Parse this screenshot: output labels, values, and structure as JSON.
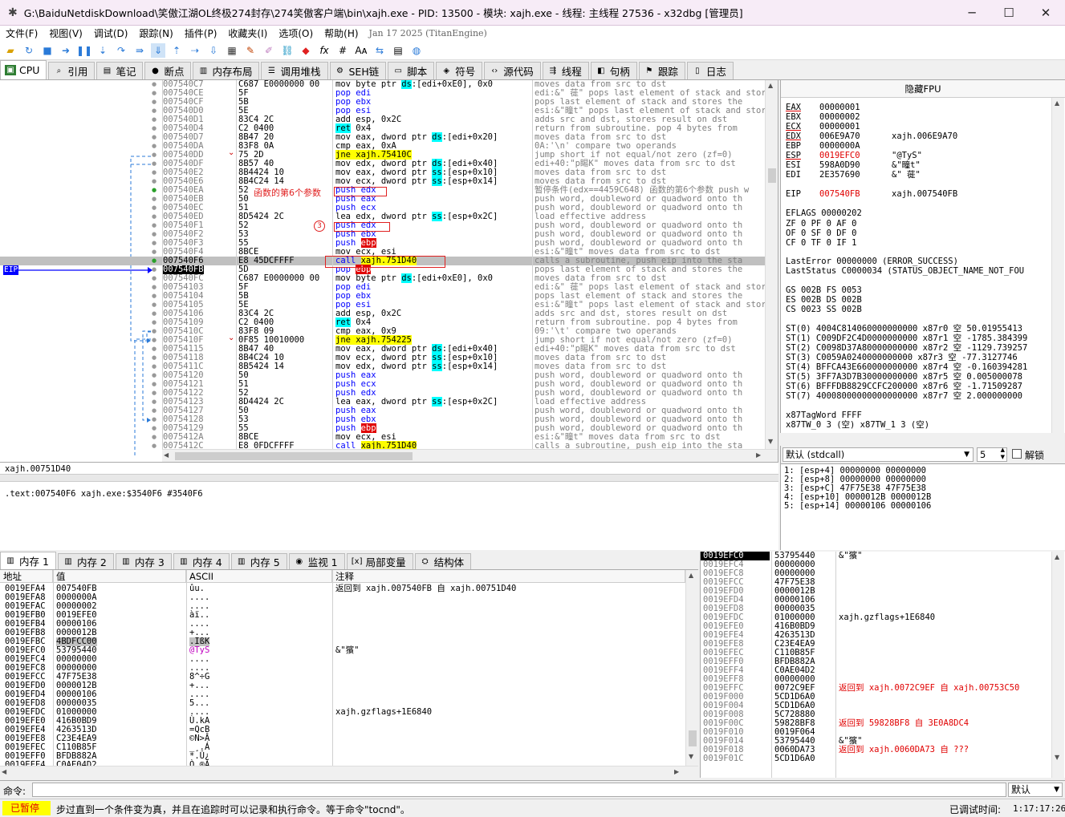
{
  "window": {
    "title": "G:\\BaiduNetdiskDownload\\笑傲江湖OL终极274封存\\274笑傲客户端\\bin\\xajh.exe - PID: 13500 - 模块: xajh.exe - 线程: 主线程 27536 - x32dbg [管理员]",
    "min": "─",
    "max": "☐",
    "close": "✕"
  },
  "menu": {
    "items": [
      "文件(F)",
      "视图(V)",
      "调试(D)",
      "跟踪(N)",
      "插件(P)",
      "收藏夹(I)",
      "选项(O)",
      "帮助(H)"
    ],
    "date": "Jan 17 2025 (TitanEngine)"
  },
  "tabs": [
    {
      "label": "CPU",
      "icon": "cpu-icon"
    },
    {
      "label": "引用",
      "icon": "search-icon"
    },
    {
      "label": "笔记",
      "icon": "notes-icon"
    },
    {
      "label": "断点",
      "icon": "breakpoint-icon"
    },
    {
      "label": "内存布局",
      "icon": "memory-map-icon"
    },
    {
      "label": "调用堆栈",
      "icon": "call-stack-icon"
    },
    {
      "label": "SEH链",
      "icon": "seh-icon"
    },
    {
      "label": "脚本",
      "icon": "script-icon"
    },
    {
      "label": "符号",
      "icon": "symbol-icon"
    },
    {
      "label": "源代码",
      "icon": "source-icon"
    },
    {
      "label": "线程",
      "icon": "thread-icon"
    },
    {
      "label": "句柄",
      "icon": "handle-icon"
    },
    {
      "label": "跟踪",
      "icon": "trace-icon"
    },
    {
      "label": "日志",
      "icon": "log-icon"
    }
  ],
  "disasm": [
    {
      "addr": "007540C7",
      "bytes": "C687 E0000000 00",
      "ins": [
        [
          "",
          "mov byte ptr "
        ],
        [
          "seg",
          "ds"
        ],
        [
          "",
          ":[edi+0xE0], 0x0"
        ]
      ],
      "cmt": "moves data from src to dst"
    },
    {
      "addr": "007540CE",
      "bytes": "5F",
      "ins": [
        [
          "push",
          "pop edi"
        ]
      ],
      "cmt": "edi:&\" 蓰\" pops last element of stack and stores the"
    },
    {
      "addr": "007540CF",
      "bytes": "5B",
      "ins": [
        [
          "push",
          "pop ebx"
        ]
      ],
      "cmt": "pops last element of stack and stores the"
    },
    {
      "addr": "007540D0",
      "bytes": "5E",
      "ins": [
        [
          "push",
          "pop esi"
        ]
      ],
      "cmt": "esi:&\"疃t\" pops last element of stack and stores the"
    },
    {
      "addr": "007540D1",
      "bytes": "83C4 2C",
      "ins": [
        [
          "",
          "add esp, 0x2C"
        ]
      ],
      "cmt": "adds src and dst, stores result on dst"
    },
    {
      "addr": "007540D4",
      "bytes": "C2 0400",
      "ins": [
        [
          "ret",
          "ret"
        ],
        [
          "",
          " 0x4"
        ]
      ],
      "cmt": "return from subroutine. pop 4 bytes from"
    },
    {
      "addr": "007540D7",
      "bytes": "8B47 20",
      "ins": [
        [
          "",
          "mov eax, dword ptr "
        ],
        [
          "seg",
          "ds"
        ],
        [
          "",
          ":[edi+0x20]"
        ]
      ],
      "cmt": "moves data from src to dst"
    },
    {
      "addr": "007540DA",
      "bytes": "83F8 0A",
      "ins": [
        [
          "",
          "cmp eax, 0xA"
        ]
      ],
      "cmt": "0A:'\\n' compare two operands"
    },
    {
      "addr": "007540DD",
      "bytes": "75 2D",
      "ins": [
        [
          "jmp",
          "jne xajh.75410C"
        ]
      ],
      "cmt": "jump short if not equal/not zero (zf=0)"
    },
    {
      "addr": "007540DF",
      "bytes": "8B57 40",
      "ins": [
        [
          "",
          "mov edx, dword ptr "
        ],
        [
          "seg",
          "ds"
        ],
        [
          "",
          ":[edi+0x40]"
        ]
      ],
      "cmt": "edi+40:\"p睗K\" moves data from src to dst"
    },
    {
      "addr": "007540E2",
      "bytes": "8B4424 10",
      "ins": [
        [
          "",
          "mov eax, dword ptr "
        ],
        [
          "seg",
          "ss"
        ],
        [
          "",
          ":[esp+0x10]"
        ]
      ],
      "cmt": "moves data from src to dst"
    },
    {
      "addr": "007540E6",
      "bytes": "8B4C24 14",
      "ins": [
        [
          "",
          "mov ecx, dword ptr "
        ],
        [
          "seg",
          "ss"
        ],
        [
          "",
          ":[esp+0x14]"
        ]
      ],
      "cmt": "moves data from src to dst"
    },
    {
      "addr": "007540EA",
      "bytes": "52",
      "ins": [
        [
          "push",
          "push edx"
        ]
      ],
      "cmt": "暂停条件(edx==4459C648) 函数的第6个参数 push w"
    },
    {
      "addr": "007540EB",
      "bytes": "50",
      "ins": [
        [
          "push",
          "push eax"
        ]
      ],
      "cmt": "push word, doubleword or quadword onto th"
    },
    {
      "addr": "007540EC",
      "bytes": "51",
      "ins": [
        [
          "push",
          "push ecx"
        ]
      ],
      "cmt": "push word, doubleword or quadword onto th"
    },
    {
      "addr": "007540ED",
      "bytes": "8D5424 2C",
      "ins": [
        [
          "",
          "lea edx, dword ptr "
        ],
        [
          "seg",
          "ss"
        ],
        [
          "",
          ":[esp+0x2C]"
        ]
      ],
      "cmt": "load effective address"
    },
    {
      "addr": "007540F1",
      "bytes": "52",
      "ins": [
        [
          "push",
          "push edx"
        ]
      ],
      "cmt": "push word, doubleword or quadword onto th"
    },
    {
      "addr": "007540F2",
      "bytes": "53",
      "ins": [
        [
          "push",
          "push ebx"
        ]
      ],
      "cmt": "push word, doubleword or quadword onto th"
    },
    {
      "addr": "007540F3",
      "bytes": "55",
      "ins": [
        [
          "push",
          "push "
        ],
        [
          "ebp",
          "ebp"
        ]
      ],
      "cmt": "push word, doubleword or quadword onto th"
    },
    {
      "addr": "007540F4",
      "bytes": "8BCE",
      "ins": [
        [
          "",
          "mov ecx, esi"
        ]
      ],
      "cmt": "esi:&\"疃t\" moves data from src to dst"
    },
    {
      "addr": "007540F6",
      "bytes": "E8 45DCFFFF",
      "ins": [
        [
          "push",
          "call "
        ],
        [
          "call",
          "xajh.751D40"
        ]
      ],
      "cmt": "calls a subroutine, push eip into the sta",
      "sel": true
    },
    {
      "addr": "007540FB",
      "bytes": "5D",
      "ins": [
        [
          "push",
          "pop "
        ],
        [
          "ebp",
          "ebp"
        ]
      ],
      "cmt": "pops last element of stack and stores the",
      "eip": true
    },
    {
      "addr": "007540FC",
      "bytes": "C687 E0000000 00",
      "ins": [
        [
          "",
          "mov byte ptr "
        ],
        [
          "seg",
          "ds"
        ],
        [
          "",
          ":[edi+0xE0], 0x0"
        ]
      ],
      "cmt": "moves data from src to dst"
    },
    {
      "addr": "00754103",
      "bytes": "5F",
      "ins": [
        [
          "push",
          "pop edi"
        ]
      ],
      "cmt": "edi:&\" 蓰\" pops last element of stack and stores the"
    },
    {
      "addr": "00754104",
      "bytes": "5B",
      "ins": [
        [
          "push",
          "pop ebx"
        ]
      ],
      "cmt": "pops last element of stack and stores the"
    },
    {
      "addr": "00754105",
      "bytes": "5E",
      "ins": [
        [
          "push",
          "pop esi"
        ]
      ],
      "cmt": "esi:&\"疃t\" pops last element of stack and stores the"
    },
    {
      "addr": "00754106",
      "bytes": "83C4 2C",
      "ins": [
        [
          "",
          "add esp, 0x2C"
        ]
      ],
      "cmt": "adds src and dst, stores result on dst"
    },
    {
      "addr": "00754109",
      "bytes": "C2 0400",
      "ins": [
        [
          "ret",
          "ret"
        ],
        [
          "",
          " 0x4"
        ]
      ],
      "cmt": "return from subroutine. pop 4 bytes from"
    },
    {
      "addr": "0075410C",
      "bytes": "83F8 09",
      "ins": [
        [
          "",
          "cmp eax, 0x9"
        ]
      ],
      "cmt": "09:'\\t' compare two operands"
    },
    {
      "addr": "0075410F",
      "bytes": "0F85 10010000",
      "ins": [
        [
          "jmp",
          "jne xajh.754225"
        ]
      ],
      "cmt": "jump short if not equal/not zero (zf=0)"
    },
    {
      "addr": "00754115",
      "bytes": "8B47 40",
      "ins": [
        [
          "",
          "mov eax, dword ptr "
        ],
        [
          "seg",
          "ds"
        ],
        [
          "",
          ":[edi+0x40]"
        ]
      ],
      "cmt": "edi+40:\"p睗K\" moves data from src to dst"
    },
    {
      "addr": "00754118",
      "bytes": "8B4C24 10",
      "ins": [
        [
          "",
          "mov ecx, dword ptr "
        ],
        [
          "seg",
          "ss"
        ],
        [
          "",
          ":[esp+0x10]"
        ]
      ],
      "cmt": "moves data from src to dst"
    },
    {
      "addr": "0075411C",
      "bytes": "8B5424 14",
      "ins": [
        [
          "",
          "mov edx, dword ptr "
        ],
        [
          "seg",
          "ss"
        ],
        [
          "",
          ":[esp+0x14]"
        ]
      ],
      "cmt": "moves data from src to dst"
    },
    {
      "addr": "00754120",
      "bytes": "50",
      "ins": [
        [
          "push",
          "push eax"
        ]
      ],
      "cmt": "push word, doubleword or quadword onto th"
    },
    {
      "addr": "00754121",
      "bytes": "51",
      "ins": [
        [
          "push",
          "push ecx"
        ]
      ],
      "cmt": "push word, doubleword or quadword onto th"
    },
    {
      "addr": "00754122",
      "bytes": "52",
      "ins": [
        [
          "push",
          "push edx"
        ]
      ],
      "cmt": "push word, doubleword or quadword onto th"
    },
    {
      "addr": "00754123",
      "bytes": "8D4424 2C",
      "ins": [
        [
          "",
          "lea eax, dword ptr "
        ],
        [
          "seg",
          "ss"
        ],
        [
          "",
          ":[esp+0x2C]"
        ]
      ],
      "cmt": "load effective address"
    },
    {
      "addr": "00754127",
      "bytes": "50",
      "ins": [
        [
          "push",
          "push eax"
        ]
      ],
      "cmt": "push word, doubleword or quadword onto th"
    },
    {
      "addr": "00754128",
      "bytes": "53",
      "ins": [
        [
          "push",
          "push ebx"
        ]
      ],
      "cmt": "push word, doubleword or quadword onto th"
    },
    {
      "addr": "00754129",
      "bytes": "55",
      "ins": [
        [
          "push",
          "push "
        ],
        [
          "ebp",
          "ebp"
        ]
      ],
      "cmt": "push word, doubleword or quadword onto th"
    },
    {
      "addr": "0075412A",
      "bytes": "8BCE",
      "ins": [
        [
          "",
          "mov ecx, esi"
        ]
      ],
      "cmt": "esi:&\"疃t\" moves data from src to dst"
    },
    {
      "addr": "0075412C",
      "bytes": "E8 0FDCFFFF",
      "ins": [
        [
          "push",
          "call "
        ],
        [
          "call",
          "xajh.751D40"
        ]
      ],
      "cmt": "calls a subroutine, push eip into the sta"
    }
  ],
  "eip_label": "EIP",
  "annotations": {
    "param6": "函数的第6个参数",
    "num3": "3"
  },
  "info": {
    "line1": "xajh.00751D40",
    "line2": ".text:007540F6 xajh.exe:$3540F6 #3540F6"
  },
  "registers": {
    "header": "隐藏FPU",
    "gp": [
      {
        "n": "EAX",
        "v": "00000001",
        "s": "",
        "red": false,
        "ul": true
      },
      {
        "n": "EBX",
        "v": "00000002",
        "s": "",
        "red": false,
        "ul": false
      },
      {
        "n": "ECX",
        "v": "00000001",
        "s": "",
        "red": false,
        "ul": true
      },
      {
        "n": "EDX",
        "v": "006E9A70",
        "s": "xajh.006E9A70",
        "red": false,
        "ul": true
      },
      {
        "n": "EBP",
        "v": "0000000A",
        "s": "",
        "red": false,
        "ul": false
      },
      {
        "n": "ESP",
        "v": "0019EFC0",
        "s": "\"@TyS\"",
        "red": true,
        "ul": true
      },
      {
        "n": "ESI",
        "v": "598A0D90",
        "s": "&\"疃t\"",
        "red": false,
        "ul": false
      },
      {
        "n": "EDI",
        "v": "2E357690",
        "s": "&\" 蓰\"",
        "red": false,
        "ul": false
      }
    ],
    "eip": {
      "n": "EIP",
      "v": "007540FB",
      "s": "xajh.007540FB"
    },
    "eflags": "EFLAGS    00000202",
    "flags": [
      "ZF 0  PF 0  AF 0",
      "OF 0  SF 0  DF 0",
      "CF 0  TF 0  IF 1"
    ],
    "lasterror": "LastError  00000000 (ERROR_SUCCESS)",
    "laststatus": "LastStatus C0000034 (STATUS_OBJECT_NAME_NOT_FOU",
    "seg": [
      "GS 002B  FS 0053",
      "ES 002B  DS 002B",
      "CS 0023  SS 002B"
    ],
    "st": [
      "ST(0) 4004C814060000000000 x87r0 空 50.01955413",
      "ST(1) C009DF2C4D0000000000 x87r1 空 -1785.384399",
      "ST(2) C0098D37A80000000000 x87r2 空 -1129.739257",
      "ST(3) C0059A0240000000000 x87r3 空 -77.3127746",
      "ST(4) BFFCA43E660000000000 x87r4 空 -0.160394281",
      "ST(5) 3FF7A3D7B30000000000 x87r5 空 0.005000078",
      "ST(6) BFFFDB8829CCFC200000 x87r6 空 -1.71509287",
      "ST(7) 40008000000000000000 x87r7 空 2.000000000"
    ],
    "tag": "x87TagWord FFFF",
    "tw": "x87TW_0 3 (空)        x87TW_1 3 (空)"
  },
  "callconv": {
    "value": "默认 (stdcall)",
    "count": "5",
    "unlock": "解锁"
  },
  "args": [
    "1: [esp+4]  00000000 00000000",
    "2: [esp+8]  00000000 00000000",
    "3: [esp+C]  47F75E38 47F75E38",
    "4: [esp+10] 0000012B 0000012B",
    "5: [esp+14] 00000106 00000106"
  ],
  "dumptabs": [
    {
      "label": "内存 1",
      "icon": "memory-icon"
    },
    {
      "label": "内存 2",
      "icon": "memory-icon"
    },
    {
      "label": "内存 3",
      "icon": "memory-icon"
    },
    {
      "label": "内存 4",
      "icon": "memory-icon"
    },
    {
      "label": "内存 5",
      "icon": "memory-icon"
    },
    {
      "label": "监视 1",
      "icon": "watch-icon"
    },
    {
      "label": "局部变量",
      "icon": "locals-icon"
    },
    {
      "label": "结构体",
      "icon": "struct-icon"
    }
  ],
  "dumpheaders": {
    "addr": "地址",
    "val": "值",
    "ascii": "ASCII",
    "cmt": "注释"
  },
  "dump": [
    {
      "a": "0019EFA4",
      "v": "007540FB",
      "s": "ûu.",
      "c": "返回到 xajh.007540FB 自 xajh.00751D40"
    },
    {
      "a": "0019EFA8",
      "v": "0000000A",
      "s": "....",
      "c": ""
    },
    {
      "a": "0019EFAC",
      "v": "00000002",
      "s": "....",
      "c": ""
    },
    {
      "a": "0019EFB0",
      "v": "0019EFE0",
      "s": "àï..",
      "c": ""
    },
    {
      "a": "0019EFB4",
      "v": "00000106",
      "s": "....",
      "c": ""
    },
    {
      "a": "0019EFB8",
      "v": "0000012B",
      "s": "+...",
      "c": ""
    },
    {
      "a": "0019EFBC",
      "v": "4BDFCC00",
      "s": ".IßK",
      "c": "",
      "hl": true
    },
    {
      "a": "0019EFC0",
      "v": "53795440",
      "s": "@TyS",
      "c": "&\"獱\""
    },
    {
      "a": "0019EFC4",
      "v": "00000000",
      "s": "....",
      "c": ""
    },
    {
      "a": "0019EFC8",
      "v": "00000000",
      "s": "....",
      "c": ""
    },
    {
      "a": "0019EFCC",
      "v": "47F75E38",
      "s": "8^÷G",
      "c": ""
    },
    {
      "a": "0019EFD0",
      "v": "0000012B",
      "s": "+...",
      "c": ""
    },
    {
      "a": "0019EFD4",
      "v": "00000106",
      "s": "....",
      "c": ""
    },
    {
      "a": "0019EFD8",
      "v": "00000035",
      "s": "5...",
      "c": ""
    },
    {
      "a": "0019EFDC",
      "v": "01000000",
      "s": "....",
      "c": "xajh.gzflags+1E6840"
    },
    {
      "a": "0019EFE0",
      "v": "416B0BD9",
      "s": "Ù.kA",
      "c": ""
    },
    {
      "a": "0019EFE4",
      "v": "4263513D",
      "s": "=QcB",
      "c": ""
    },
    {
      "a": "0019EFE8",
      "v": "C23E4EA9",
      "s": "©N>Â",
      "c": ""
    },
    {
      "a": "0019EFEC",
      "v": "C110B85F",
      "s": "_¸.Á",
      "c": ""
    },
    {
      "a": "0019EFF0",
      "v": "BFDB882A",
      "s": "*.Û¿",
      "c": ""
    },
    {
      "a": "0019EFF4",
      "v": "C0AE04D2",
      "s": "Ò.®À",
      "c": ""
    }
  ],
  "stack": [
    {
      "a": "0019EFC0",
      "v": "53795440",
      "c": "&\"獱\"",
      "cur": true
    },
    {
      "a": "0019EFC4",
      "v": "00000000",
      "c": ""
    },
    {
      "a": "0019EFC8",
      "v": "00000000",
      "c": ""
    },
    {
      "a": "0019EFCC",
      "v": "47F75E38",
      "c": ""
    },
    {
      "a": "0019EFD0",
      "v": "0000012B",
      "c": ""
    },
    {
      "a": "0019EFD4",
      "v": "00000106",
      "c": ""
    },
    {
      "a": "0019EFD8",
      "v": "00000035",
      "c": ""
    },
    {
      "a": "0019EFDC",
      "v": "01000000",
      "c": "xajh.gzflags+1E6840"
    },
    {
      "a": "0019EFE0",
      "v": "416B0BD9",
      "c": ""
    },
    {
      "a": "0019EFE4",
      "v": "4263513D",
      "c": ""
    },
    {
      "a": "0019EFE8",
      "v": "C23E4EA9",
      "c": ""
    },
    {
      "a": "0019EFEC",
      "v": "C110B85F",
      "c": ""
    },
    {
      "a": "0019EFF0",
      "v": "BFDB882A",
      "c": ""
    },
    {
      "a": "0019EFF4",
      "v": "C0AE04D2",
      "c": ""
    },
    {
      "a": "0019EFF8",
      "v": "00000000",
      "c": ""
    },
    {
      "a": "0019EFFC",
      "v": "0072C9EF",
      "c": "返回到 xajh.0072C9EF 自 xajh.00753C50",
      "red": true
    },
    {
      "a": "0019F000",
      "v": "5CD1D6A0",
      "c": ""
    },
    {
      "a": "0019F004",
      "v": "5CD1D6A0",
      "c": ""
    },
    {
      "a": "0019F008",
      "v": "5C728880",
      "c": ""
    },
    {
      "a": "0019F00C",
      "v": "59828BF8",
      "c": "返回到 59828BF8 自 3E0A8DC4",
      "red": true
    },
    {
      "a": "0019F010",
      "v": "0019F064",
      "c": ""
    },
    {
      "a": "0019F014",
      "v": "53795440",
      "c": "&\"獱\""
    },
    {
      "a": "0019F018",
      "v": "0060DA73",
      "c": "返回到 xajh.0060DA73 自 ???",
      "red": true
    },
    {
      "a": "0019F01C",
      "v": "5CD1D6A0",
      "c": ""
    }
  ],
  "cmd": {
    "label": "命令:",
    "placeholder": "",
    "right": "默认"
  },
  "status": {
    "state": "已暂停",
    "msg": "步过直到一个条件变为真，并且在追踪时可以记录和执行命令。等于命令\"tocnd\"。",
    "timelabel": "已调试时间:",
    "time": "1:17:17:26"
  }
}
